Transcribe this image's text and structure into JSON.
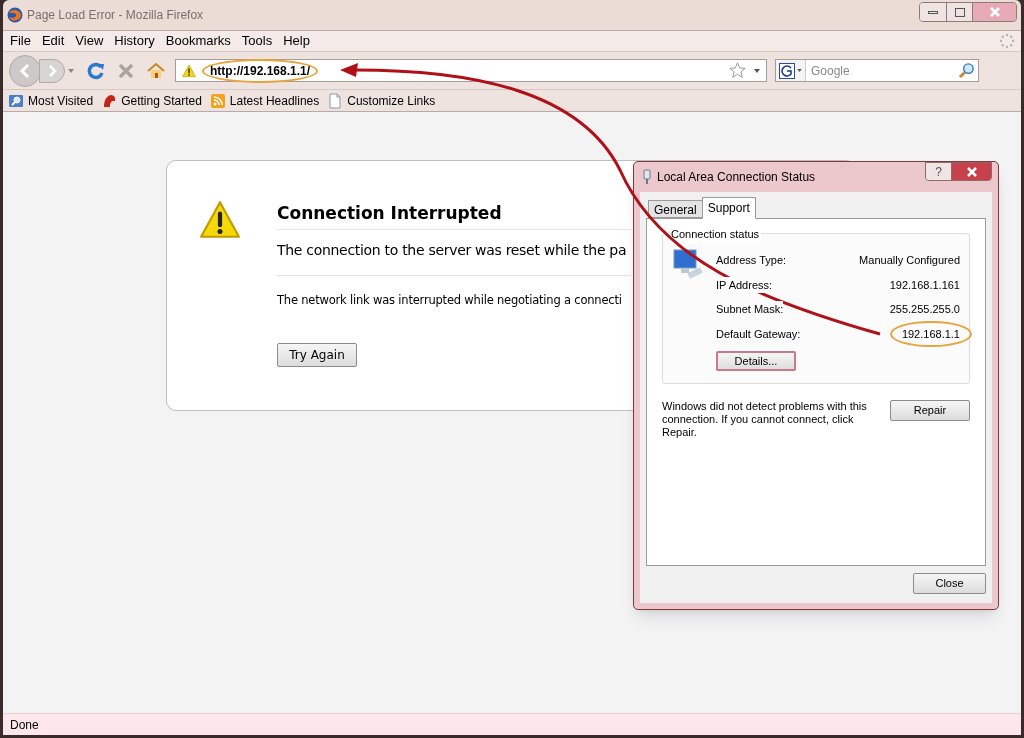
{
  "window": {
    "title": "Page Load Error - Mozilla Firefox"
  },
  "menu": [
    {
      "label": "File"
    },
    {
      "label": "Edit"
    },
    {
      "label": "View"
    },
    {
      "label": "History"
    },
    {
      "label": "Bookmarks"
    },
    {
      "label": "Tools"
    },
    {
      "label": "Help"
    }
  ],
  "address_bar": {
    "value": "http://192.168.1.1/",
    "highlighted": true
  },
  "search_field": {
    "placeholder": "Google"
  },
  "bookmarks": [
    {
      "kind": "smart",
      "label": "Most Visited"
    },
    {
      "kind": "site",
      "label": "Getting Started"
    },
    {
      "kind": "feed",
      "label": "Latest Headlines"
    },
    {
      "kind": "page",
      "label": "Customize Links"
    }
  ],
  "error_page": {
    "title": "Connection Interrupted",
    "description": "The connection to the server was reset while the pa",
    "details": "The network link was interrupted while negotiating a connecti",
    "button": "Try Again"
  },
  "dialog": {
    "title": "Local Area Connection Status",
    "help_button": "?",
    "tabs": [
      {
        "label": "General",
        "selected": false
      },
      {
        "label": "Support",
        "selected": true
      }
    ],
    "group_label": "Connection status",
    "rows": [
      {
        "label": "Address Type:",
        "value": "Manually Configured",
        "highlighted": false
      },
      {
        "label": "IP Address:",
        "value": "192.168.1.161",
        "highlighted": false
      },
      {
        "label": "Subnet Mask:",
        "value": "255.255.255.0",
        "highlighted": false
      },
      {
        "label": "Default Gateway:",
        "value": "192.168.1.1",
        "highlighted": true
      }
    ],
    "details_button": "Details...",
    "message": "Windows did not detect problems with this connection. If you cannot connect, click Repair.",
    "repair_button": "Repair",
    "close_button": "Close"
  },
  "status_bar": {
    "text": "Done"
  }
}
